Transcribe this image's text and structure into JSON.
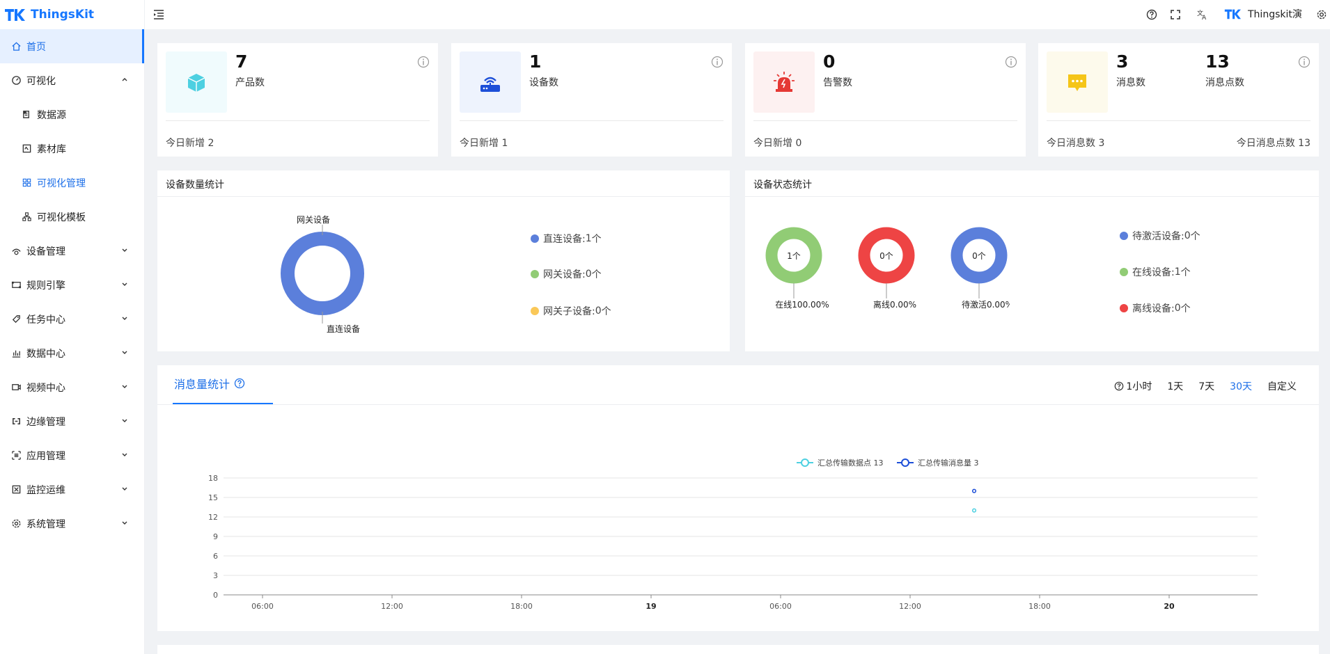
{
  "app": {
    "name": "ThingsKit"
  },
  "sidebar": {
    "items": [
      {
        "label": "首页",
        "icon": "home-icon",
        "active": true
      },
      {
        "label": "可视化",
        "icon": "dashboard-icon",
        "expanded": true
      },
      {
        "label": "数据源",
        "icon": "datasource-icon",
        "sub": true
      },
      {
        "label": "素材库",
        "icon": "material-icon",
        "sub": true
      },
      {
        "label": "可视化管理",
        "icon": "grid-icon",
        "sub": true,
        "sub_active": true
      },
      {
        "label": "可视化模板",
        "icon": "template-icon",
        "sub": true
      },
      {
        "label": "设备管理",
        "icon": "device-icon"
      },
      {
        "label": "规则引擎",
        "icon": "rule-icon"
      },
      {
        "label": "任务中心",
        "icon": "task-icon"
      },
      {
        "label": "数据中心",
        "icon": "chart-icon"
      },
      {
        "label": "视频中心",
        "icon": "video-icon"
      },
      {
        "label": "边缘管理",
        "icon": "edge-icon"
      },
      {
        "label": "应用管理",
        "icon": "app-icon"
      },
      {
        "label": "监控运维",
        "icon": "monitor-icon"
      },
      {
        "label": "系统管理",
        "icon": "settings-icon"
      }
    ]
  },
  "header": {
    "user": "Thingskit演"
  },
  "stats": [
    {
      "value": "7",
      "label": "产品数",
      "foot": "今日新增 2",
      "icon": "cube-icon",
      "bg": "#f0fbfd",
      "color": "#4dd0e1"
    },
    {
      "value": "1",
      "label": "设备数",
      "foot": "今日新增 1",
      "icon": "router-icon",
      "bg": "#eef3fd",
      "color": "#1d4fd8"
    },
    {
      "value": "0",
      "label": "告警数",
      "foot": "今日新增 0",
      "icon": "alarm-icon",
      "bg": "#fdf1f1",
      "color": "#e53935"
    },
    {
      "value": "3",
      "label": "消息数",
      "value2": "13",
      "label2": "消息点数",
      "foot": "今日消息数 3",
      "foot2": "今日消息点数 13",
      "icon": "message-icon",
      "bg": "#fdfaec",
      "color": "#f5c518"
    }
  ],
  "device_count": {
    "title": "设备数量统计",
    "donut_labels": [
      "网关设备",
      "直连设备"
    ],
    "legend": [
      {
        "label": "直连设备:",
        "value": "1",
        "unit": "个",
        "color": "#5b7fdb"
      },
      {
        "label": "网关设备:",
        "value": "0",
        "unit": "个",
        "color": "#91cc75"
      },
      {
        "label": "网关子设备:",
        "value": "0",
        "unit": "个",
        "color": "#fac858"
      }
    ]
  },
  "device_status": {
    "title": "设备状态统计",
    "rings": [
      {
        "center": "1个",
        "caption": "在线100.00%",
        "color": "#91cc75"
      },
      {
        "center": "0个",
        "caption": "离线0.00%",
        "color": "#ee4444"
      },
      {
        "center": "0个",
        "caption": "待激活0.00%",
        "color": "#5b7fdb"
      }
    ],
    "legend": [
      {
        "label": "待激活设备:",
        "value": "0",
        "unit": "个",
        "color": "#5b7fdb"
      },
      {
        "label": "在线设备:",
        "value": "1",
        "unit": "个",
        "color": "#91cc75"
      },
      {
        "label": "离线设备:",
        "value": "0",
        "unit": "个",
        "color": "#ee4444"
      }
    ]
  },
  "messages": {
    "tab": "消息量统计",
    "ranges": [
      "1小时",
      "1天",
      "7天",
      "30天",
      "自定义"
    ],
    "active_range": "30天"
  },
  "chart_data": {
    "type": "line",
    "legend": [
      "汇总传输数据点 13",
      "汇总传输消息量 3"
    ],
    "series": [
      {
        "name": "汇总传输数据点 13",
        "color": "#4dd0e1",
        "points": [
          {
            "x": "19 22:00",
            "y": 13
          }
        ]
      },
      {
        "name": "汇总传输消息量 3",
        "color": "#1d4fd8",
        "points": [
          {
            "x": "19 22:00",
            "y": 16
          }
        ]
      }
    ],
    "x_ticks": [
      "06:00",
      "12:00",
      "18:00",
      "19",
      "06:00",
      "12:00",
      "18:00",
      "20"
    ],
    "y_ticks": [
      0,
      3,
      6,
      9,
      12,
      15,
      18
    ],
    "ylim": [
      0,
      18
    ]
  }
}
